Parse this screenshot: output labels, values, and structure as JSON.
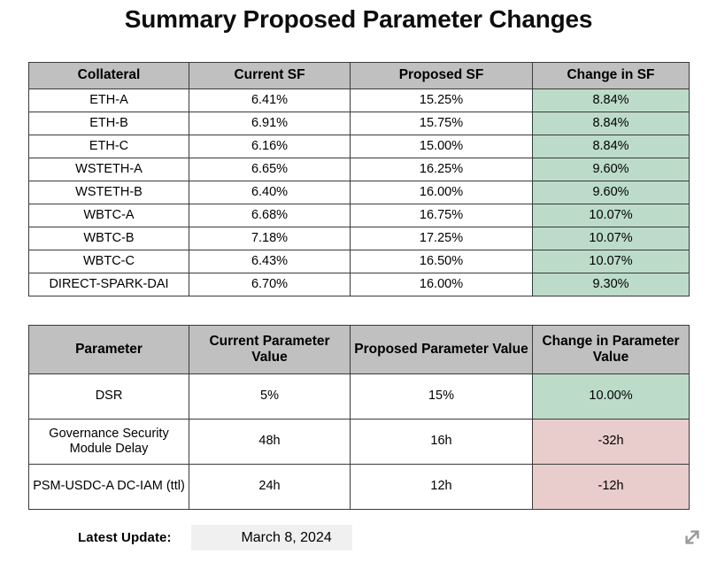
{
  "page_title": "Summary Proposed Parameter Changes",
  "colors": {
    "header_gray": "#c0c0c0",
    "positive_green": "#bcdcc9",
    "negative_pink": "#e9cdcd",
    "border": "#3a3a3a",
    "value_highlight": "#f0f0f0",
    "icon_gray": "#9a9a9a"
  },
  "stability_fee_table": {
    "columns": [
      "Collateral",
      "Current SF",
      "Proposed SF",
      "Change in SF"
    ],
    "rows": [
      {
        "collateral": "ETH-A",
        "current_sf": "6.41%",
        "proposed_sf": "15.25%",
        "change_sf": "8.84%",
        "change_sign": "pos"
      },
      {
        "collateral": "ETH-B",
        "current_sf": "6.91%",
        "proposed_sf": "15.75%",
        "change_sf": "8.84%",
        "change_sign": "pos"
      },
      {
        "collateral": "ETH-C",
        "current_sf": "6.16%",
        "proposed_sf": "15.00%",
        "change_sf": "8.84%",
        "change_sign": "pos"
      },
      {
        "collateral": "WSTETH-A",
        "current_sf": "6.65%",
        "proposed_sf": "16.25%",
        "change_sf": "9.60%",
        "change_sign": "pos"
      },
      {
        "collateral": "WSTETH-B",
        "current_sf": "6.40%",
        "proposed_sf": "16.00%",
        "change_sf": "9.60%",
        "change_sign": "pos"
      },
      {
        "collateral": "WBTC-A",
        "current_sf": "6.68%",
        "proposed_sf": "16.75%",
        "change_sf": "10.07%",
        "change_sign": "pos"
      },
      {
        "collateral": "WBTC-B",
        "current_sf": "7.18%",
        "proposed_sf": "17.25%",
        "change_sf": "10.07%",
        "change_sign": "pos"
      },
      {
        "collateral": "WBTC-C",
        "current_sf": "6.43%",
        "proposed_sf": "16.50%",
        "change_sf": "10.07%",
        "change_sign": "pos"
      },
      {
        "collateral": "DIRECT-SPARK-DAI",
        "current_sf": "6.70%",
        "proposed_sf": "16.00%",
        "change_sf": "9.30%",
        "change_sign": "pos"
      }
    ]
  },
  "parameter_table": {
    "columns": [
      "Parameter",
      "Current Parameter Value",
      "Proposed Parameter Value",
      "Change in Parameter Value"
    ],
    "rows": [
      {
        "parameter": "DSR",
        "current_value": "5%",
        "proposed_value": "15%",
        "change_value": "10.00%",
        "change_sign": "pos"
      },
      {
        "parameter": "Governance Security Module Delay",
        "current_value": "48h",
        "proposed_value": "16h",
        "change_value": "-32h",
        "change_sign": "neg"
      },
      {
        "parameter": "PSM-USDC-A DC-IAM (ttl)",
        "current_value": "24h",
        "proposed_value": "12h",
        "change_value": "-12h",
        "change_sign": "neg"
      }
    ]
  },
  "footer": {
    "latest_update_label": "Latest Update:",
    "latest_update_value": "March 8, 2024",
    "expand_icon": "expand-diagonal-arrows-icon"
  }
}
